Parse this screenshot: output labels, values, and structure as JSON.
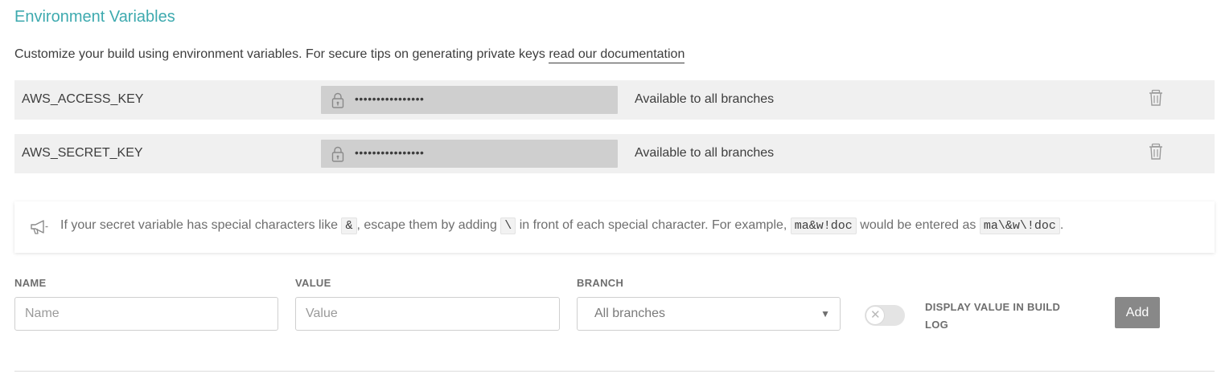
{
  "section": {
    "title": "Environment Variables",
    "description": "Customize your build using environment variables. For secure tips on generating private keys",
    "doc_link": "read our documentation"
  },
  "variables": [
    {
      "name": "AWS_ACCESS_KEY",
      "masked_value": "••••••••••••••••",
      "branch": "Available to all branches",
      "icons": [
        "lock-icon",
        "trash-icon"
      ]
    },
    {
      "name": "AWS_SECRET_KEY",
      "masked_value": "••••••••••••••••",
      "branch": "Available to all branches",
      "icons": [
        "lock-icon",
        "trash-icon"
      ]
    }
  ],
  "notice": {
    "icon": "megaphone-icon",
    "part1": "If your secret variable has special characters like ",
    "code1": "&",
    "part2": ", escape them by adding ",
    "code2": "\\",
    "part3": " in front of each special character. For example, ",
    "code3": "ma&w!doc",
    "part4": " would be entered as ",
    "code4": "ma\\&w\\!doc",
    "part5": "."
  },
  "form": {
    "name_label": "NAME",
    "name_placeholder": "Name",
    "value_label": "VALUE",
    "value_placeholder": "Value",
    "branch_label": "BRANCH",
    "branch_selected": "All branches",
    "display_toggle_label": "DISPLAY VALUE IN BUILD LOG",
    "display_toggle_on": false,
    "add_button": "Add"
  },
  "colors": {
    "title_accent": "#3eaaaf",
    "row_background": "#f0f0f0",
    "masked_field": "#cfcfcf",
    "add_button": "#888888"
  }
}
